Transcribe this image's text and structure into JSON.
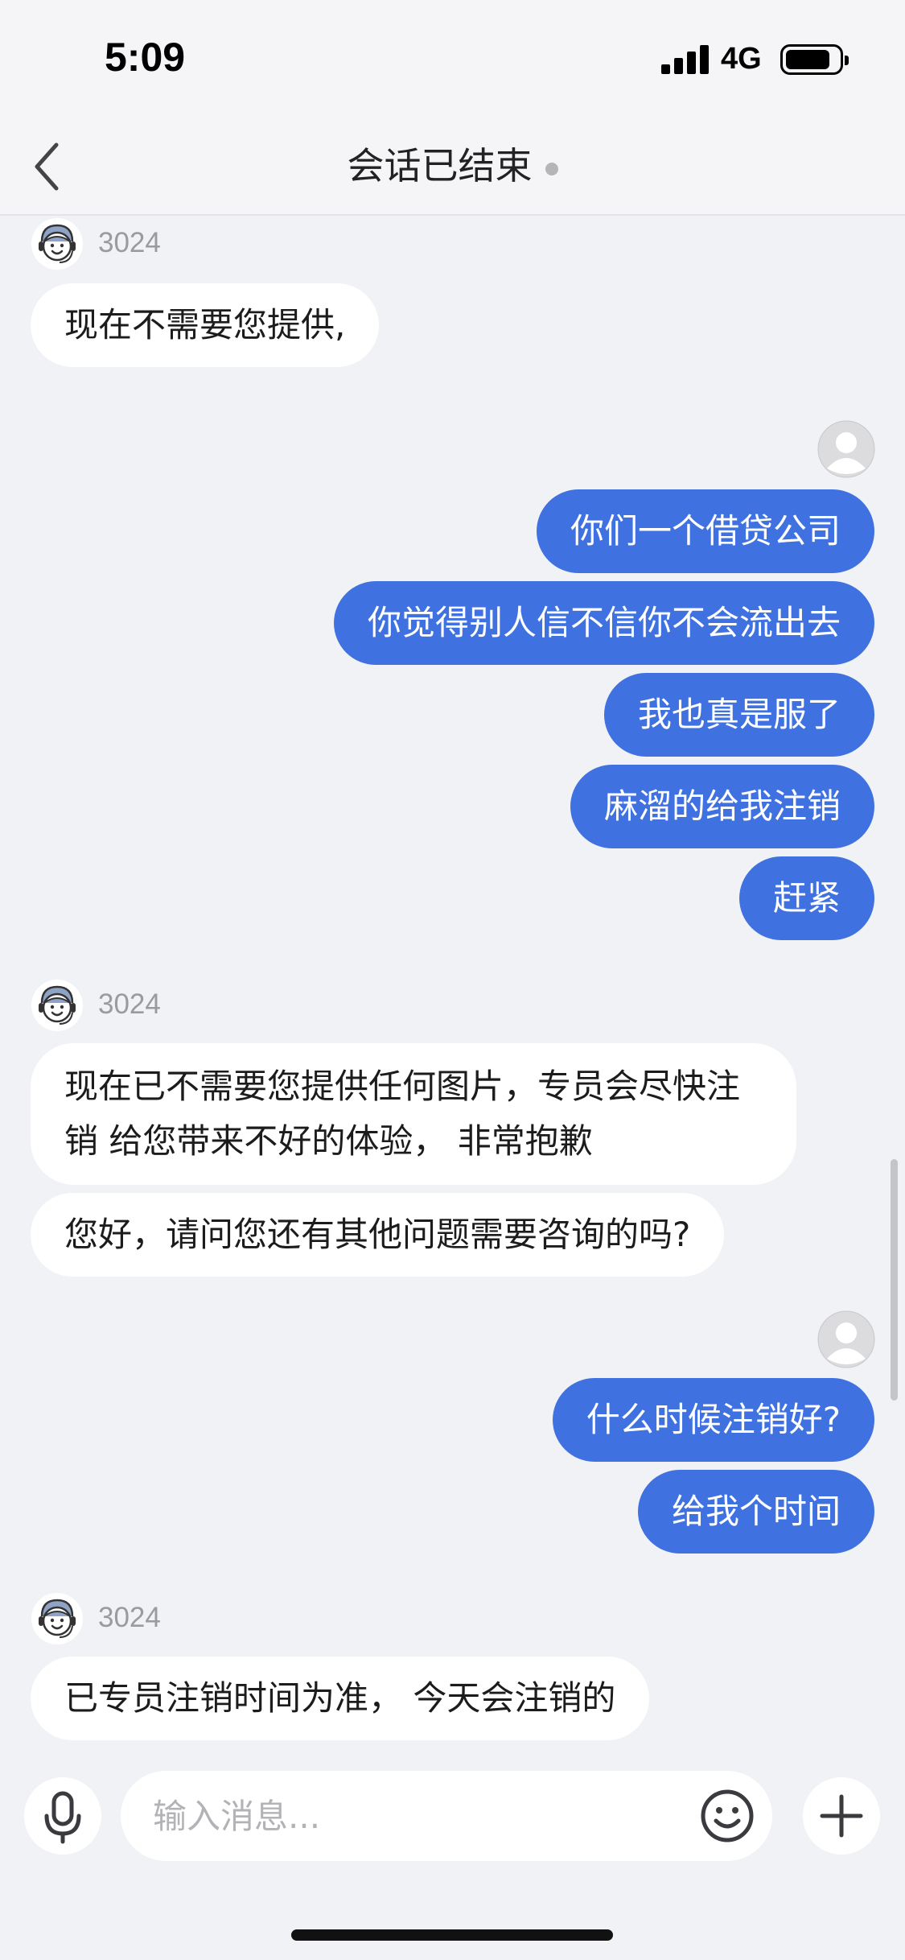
{
  "status_bar": {
    "time": "5:09",
    "network": "4G"
  },
  "nav": {
    "title": "会话已结束"
  },
  "agent": {
    "name": "3024"
  },
  "messages": {
    "m1": "现在不需要您提供,",
    "m2": "你们一个借贷公司",
    "m3": "你觉得别人信不信你不会流出去",
    "m4": "我也真是服了",
    "m5": "麻溜的给我注销",
    "m6": "赶紧",
    "m7": "现在已不需要您提供任何图片，专员会尽快注销   给您带来不好的体验，  非常抱歉",
    "m8": "您好，请问您还有其他问题需要咨询的吗?",
    "m9": "什么时候注销好?",
    "m10": "给我个时间",
    "m11": "已专员注销时间为准， 今天会注销的"
  },
  "input": {
    "placeholder": "输入消息..."
  },
  "icons": {
    "back": "chevron-left-icon",
    "mic": "microphone-icon",
    "emoji": "smiley-icon",
    "plus": "plus-icon",
    "agent_avatar": "headset-agent-icon",
    "user_avatar": "default-user-icon"
  },
  "colors": {
    "outgoing_bubble": "#3f72e0",
    "background": "#f1f2f5"
  }
}
